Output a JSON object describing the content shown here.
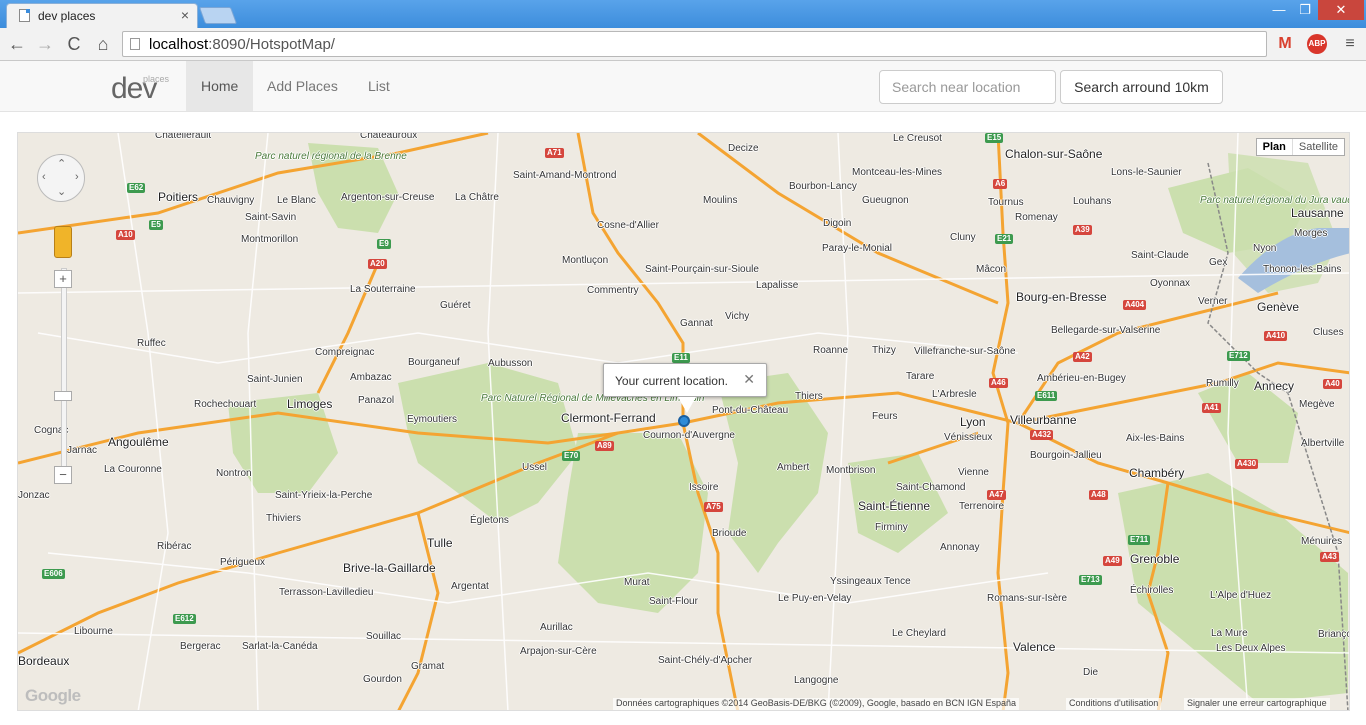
{
  "browser": {
    "tab_title": "dev places",
    "tab_close": "×",
    "url_host": "localhost",
    "url_rest": ":8090/HotspotMap/",
    "window_min": "—",
    "window_max": "❐",
    "window_close": "✕",
    "back_icon": "←",
    "forward_icon": "→",
    "reload_icon": "C",
    "home_icon": "⌂",
    "gmail_icon": "M",
    "abp_icon": "ABP",
    "menu_icon": "≡"
  },
  "navbar": {
    "brand": "dev",
    "brand_sup": "places",
    "links": [
      "Home",
      "Add Places",
      "List"
    ],
    "search_placeholder": "Search near location",
    "search_button": "Search arround 10km"
  },
  "map": {
    "type_plan": "Plan",
    "type_satellite": "Satellite",
    "zoom_in": "+",
    "zoom_out": "−",
    "infowindow_text": "Your current location.",
    "infowindow_close": "✕",
    "google_logo": "Google",
    "attribution_data": "Données cartographiques ©2014 GeoBasis-DE/BKG (©2009), Google, basado en BCN IGN España",
    "attribution_conditions": "Conditions d'utilisation",
    "attribution_error": "Signaler une erreur cartographique",
    "colors": {
      "land": "#eeeae2",
      "park": "#cbdfae",
      "highway": "#f4a432",
      "road": "#ffffff",
      "water": "#a5bfdd",
      "marker": "#2f8bd8"
    },
    "cities": [
      "Chatellerault",
      "Chateauroux",
      "Le Creusot",
      "Chalon-sur-Saône",
      "Poitiers",
      "Chauvigny",
      "Le Blanc",
      "Argenton-sur-Creuse",
      "La Châtre",
      "Saint-Amand-Montrond",
      "Decize",
      "Montceau-les-Mines",
      "Moulins",
      "Bourbon-Lancy",
      "Gueugnon",
      "Tournus",
      "Louhans",
      "Lons-le-Saunier",
      "Romenay",
      "Lausanne",
      "Saint-Savin",
      "Montmorillon",
      "Cosne-d'Allier",
      "Digoin",
      "Cluny",
      "Morges",
      "Paray-le-Monial",
      "Montluçon",
      "Saint-Pourçain-sur-Sioule",
      "Mâcon",
      "Saint-Claude",
      "Nyon",
      "Gex",
      "Thonon-les-Bains",
      "La Souterraine",
      "Commentry",
      "Lapalisse",
      "Bourg-en-Bresse",
      "Oyonnax",
      "Guéret",
      "Vichy",
      "Gannat",
      "Bellegarde-sur-Valserine",
      "Verner",
      "Genève",
      "Ruffec",
      "Compreignac",
      "Aubusson",
      "Roanne",
      "Thizy",
      "Villefranche-sur-Saône",
      "Cluses",
      "Bourganeuf",
      "Ambazac",
      "Saint-Junien",
      "Tarare",
      "Ambérieu-en-Bugey",
      "Rumilly",
      "Annecy",
      "Rochechouart",
      "Limoges",
      "Panazol",
      "Eymoutiers",
      "Clermont-Ferrand",
      "Pont-du-Château",
      "Thiers",
      "L'Arbresle",
      "Lyon",
      "Villeurbanne",
      "Megève",
      "Cognac",
      "Angoulême",
      "Jarnac",
      "Feurs",
      "Vénissieux",
      "Aix-les-Bains",
      "Albertville",
      "Cournon-d'Auvergne",
      "La Couronne",
      "Ussel",
      "Ambert",
      "Montbrison",
      "Bourgoin-Jallieu",
      "Chambéry",
      "Nontron",
      "Saint-Chamond",
      "Vienne",
      "Jonzac",
      "Saint-Yrieix-la-Perche",
      "Issoire",
      "Saint-Étienne",
      "Terrenoire",
      "Thiviers",
      "Égletons",
      "Firminy",
      "Ribérac",
      "Tulle",
      "Brioude",
      "Annonay",
      "Grenoble",
      "Ménuires",
      "Périgueux",
      "Brive-la-Gaillarde",
      "Argentat",
      "Murat",
      "Yssingeaux",
      "Tence",
      "Terrasson-Lavilledieu",
      "Saint-Flour",
      "Le Puy-en-Velay",
      "Romans-sur-Isère",
      "Échirolles",
      "L'Alpe d'Huez",
      "Libourne",
      "Bergerac",
      "Sarlat-la-Canéda",
      "Souillac",
      "Aurillac",
      "Le Cheylard",
      "La Mure",
      "Les Deux Alpes",
      "Briançon",
      "Arpajon-sur-Cère",
      "Valence",
      "Bordeaux",
      "Gramat",
      "Saint-Chély-d'Apcher",
      "Die",
      "Gourdon",
      "Langogne"
    ],
    "parks": [
      "Parc naturel régional de la Brenne",
      "Parc naturel régional du Jura vaudois",
      "Parc Naturel Régional de Millevaches en Limousin"
    ],
    "roads": [
      "A71",
      "A10",
      "E62",
      "E5",
      "E9",
      "A20",
      "E11",
      "A89",
      "E70",
      "A75",
      "A6",
      "E15",
      "A39",
      "E21",
      "A40",
      "A41",
      "A42",
      "A43",
      "A46",
      "A47",
      "A48",
      "A49",
      "A430",
      "A432",
      "E611",
      "E712",
      "E711",
      "E713",
      "A404",
      "A410",
      "E606",
      "E612"
    ]
  }
}
